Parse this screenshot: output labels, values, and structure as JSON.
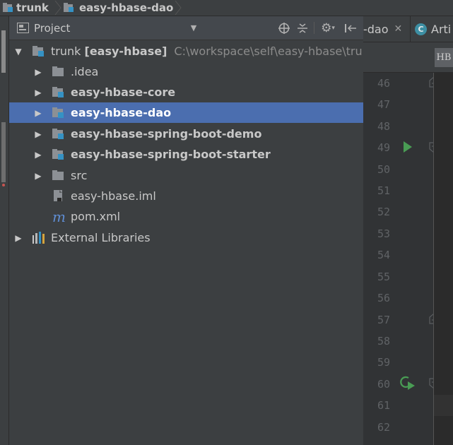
{
  "breadcrumb": {
    "items": [
      {
        "label": "trunk"
      },
      {
        "label": "easy-hbase-dao"
      }
    ]
  },
  "panel": {
    "title": "Project",
    "icons": [
      "target-icon",
      "collapse-all-icon",
      "gear-icon",
      "hide-icon"
    ]
  },
  "tree": [
    {
      "label": "trunk",
      "module": "[easy-hbase]",
      "path": "C:\\workspace\\self\\easy-hbase\\trunk",
      "kind": "module",
      "depth": 0,
      "expanded": true
    },
    {
      "label": ".idea",
      "kind": "folder",
      "depth": 1,
      "bold": false
    },
    {
      "label": "easy-hbase-core",
      "kind": "module",
      "depth": 1,
      "bold": true
    },
    {
      "label": "easy-hbase-dao",
      "kind": "module",
      "depth": 1,
      "bold": true,
      "selected": true
    },
    {
      "label": "easy-hbase-spring-boot-demo",
      "kind": "module",
      "depth": 1,
      "bold": true
    },
    {
      "label": "easy-hbase-spring-boot-starter",
      "kind": "module",
      "depth": 1,
      "bold": true
    },
    {
      "label": "src",
      "kind": "folder",
      "depth": 1,
      "bold": false
    },
    {
      "label": "easy-hbase.iml",
      "kind": "iml",
      "depth": 1,
      "bold": false
    },
    {
      "label": "pom.xml",
      "kind": "maven",
      "depth": 1,
      "bold": false
    },
    {
      "label": "External Libraries",
      "kind": "libraries",
      "depth": 0,
      "bold": false
    }
  ],
  "editor": {
    "tabs": [
      {
        "label": "-dao"
      },
      {
        "label": "Arti"
      }
    ],
    "toolbar_label": "HB",
    "line_numbers": [
      "46",
      "47",
      "48",
      "49",
      "50",
      "51",
      "52",
      "53",
      "54",
      "55",
      "56",
      "57",
      "58",
      "59",
      "60",
      "61",
      "62"
    ]
  },
  "colors": {
    "selection": "#4b6eaf",
    "panel_bg": "#3c3f41",
    "editor_bg": "#2b2b2b",
    "module_blue": "#3592c4",
    "run_green": "#499c54"
  }
}
